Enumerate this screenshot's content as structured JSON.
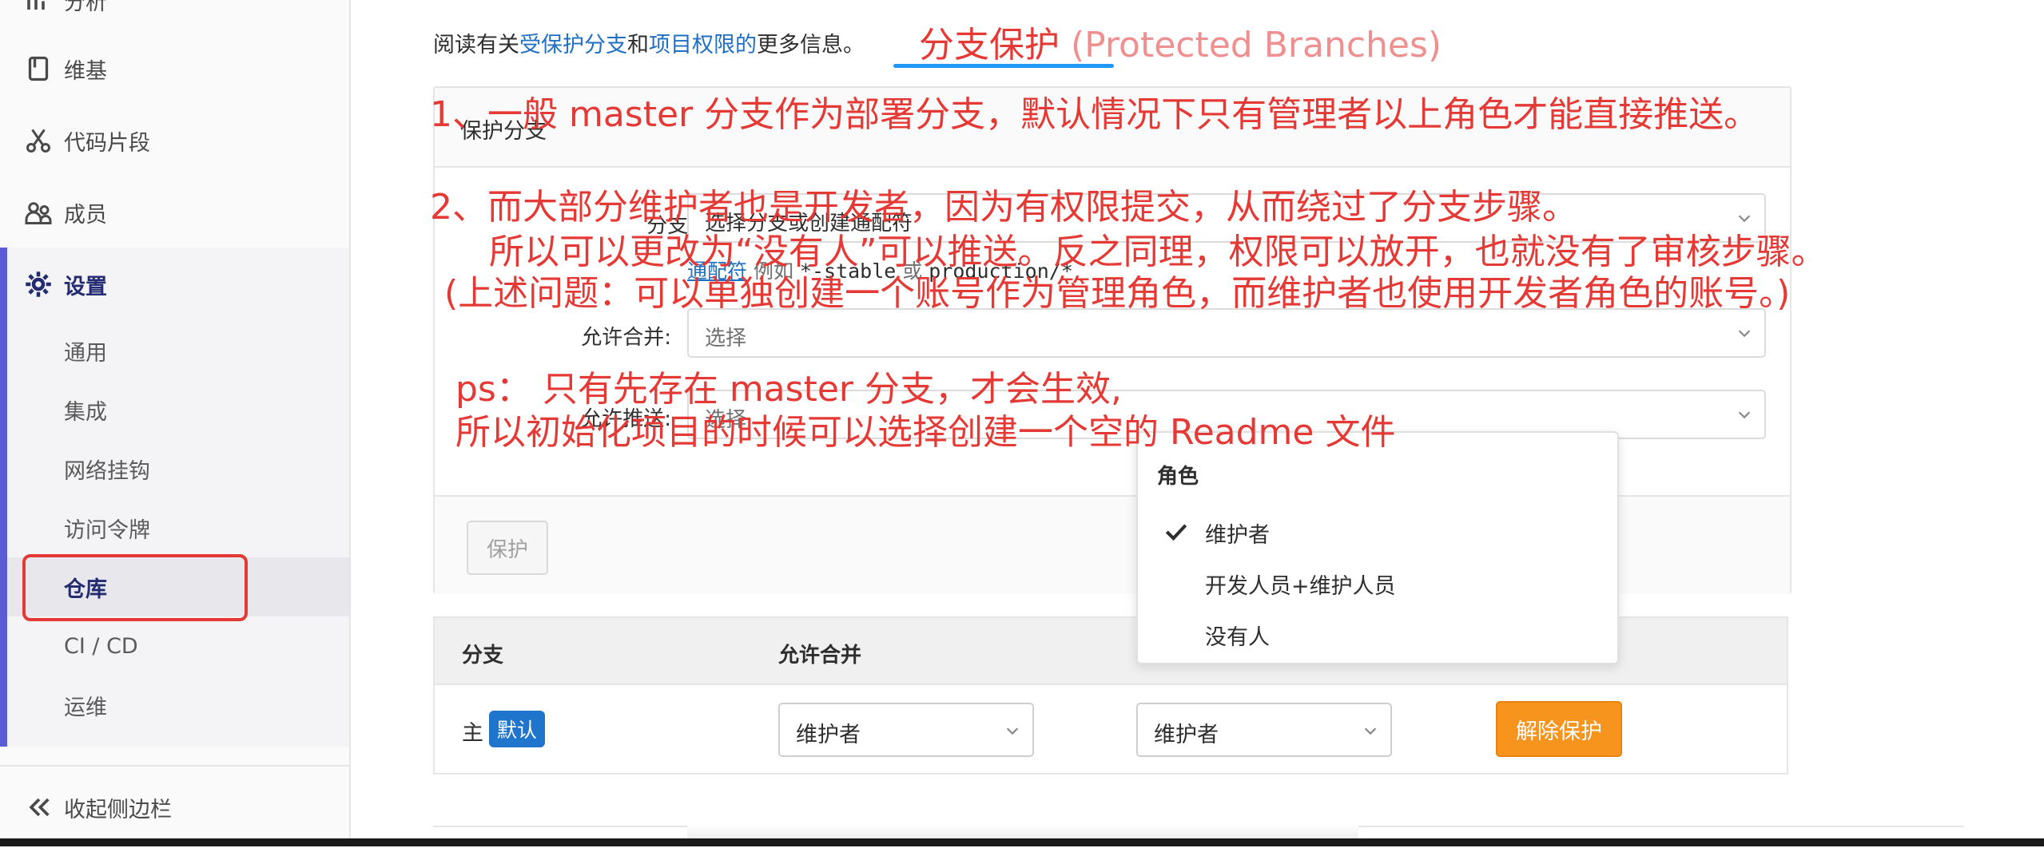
{
  "sidebar": {
    "top_items": [
      {
        "label": "分析",
        "icon": "chart-icon"
      },
      {
        "label": "维基",
        "icon": "book-icon"
      },
      {
        "label": "代码片段",
        "icon": "scissors-icon"
      },
      {
        "label": "成员",
        "icon": "users-icon"
      },
      {
        "label": "设置",
        "icon": "gear-icon"
      }
    ],
    "settings_items": [
      {
        "label": "通用"
      },
      {
        "label": "集成"
      },
      {
        "label": "网络挂钩"
      },
      {
        "label": "访问令牌"
      },
      {
        "label": "仓库"
      },
      {
        "label": "CI / CD"
      },
      {
        "label": "运维"
      }
    ],
    "collapse_label": "收起侧边栏"
  },
  "intro": {
    "prefix": "阅读有关",
    "link1": "受保护分支",
    "mid": "和",
    "link2": "项目权限的",
    "suffix": "更多信息。"
  },
  "annotations": {
    "title_cn": "分支保护 ",
    "title_en": "(Protected Branches)",
    "note1": "1、一般 master 分支作为部署分支，默认情况下只有管理者以上角色才能直接推送。",
    "note2": "2、而大部分维护者也是开发者，因为有权限提交，从而绕过了分支步骤。",
    "note3": "所以可以更改为“没有人”可以推送。反之同理，权限可以放开，也就没有了审核步骤。",
    "note4": "(上述问题：可以单独创建一个账号作为管理角色，而维护者也使用开发者角色的账号。)",
    "note5": "ps： 只有先存在 master 分支，才会生效,",
    "note6": "所以初始化项目的时候可以选择创建一个空的 Readme 文件"
  },
  "protect_form": {
    "header": "保护分支",
    "branch_label": "分支:",
    "branch_placeholder": "选择分支或创建通配符",
    "hint_link": "通配符",
    "hint_text": " 例如 ",
    "hint_code1": "*-stable",
    "hint_or": " 或 ",
    "hint_code2": "production/*",
    "merge_label": "允许合并:",
    "merge_placeholder": "选择",
    "push_label": "允许推送:",
    "push_placeholder": "选择",
    "protect_button": "保护"
  },
  "role_dropdown": {
    "header": "角色",
    "options": [
      {
        "label": "维护者",
        "selected": true
      },
      {
        "label": "开发人员+维护人员",
        "selected": false
      },
      {
        "label": "没有人",
        "selected": false
      }
    ]
  },
  "table": {
    "headers": [
      "分支",
      "允许合并"
    ],
    "rows": [
      {
        "branch": "主",
        "badge": "默认",
        "merge": "维护者",
        "push": "维护者",
        "action": "解除保护"
      }
    ]
  },
  "colors": {
    "accent": "#5b5bd6",
    "annotation_red": "#e53935",
    "link_blue": "#1f6fc5",
    "unprotect_orange": "#f7941d",
    "badge_blue": "#1f75cb"
  }
}
